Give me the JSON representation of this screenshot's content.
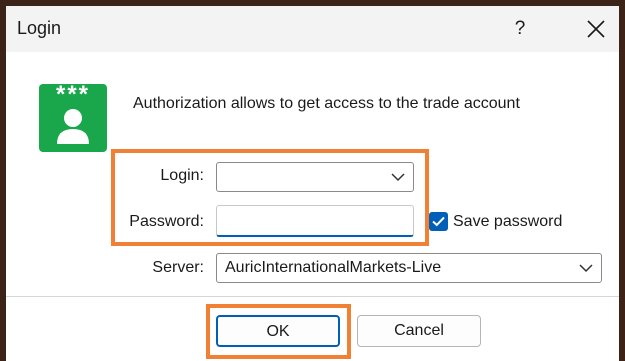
{
  "dialog": {
    "title": "Login",
    "help_label": "?",
    "close_label": "close"
  },
  "header": {
    "icon_stars": "***",
    "description": "Authorization allows to get access to the trade account"
  },
  "form": {
    "login_label": "Login:",
    "login_value": "",
    "password_label": "Password:",
    "password_value": "",
    "save_password_label": "Save password",
    "save_password_checked": true,
    "server_label": "Server:",
    "server_value": "AuricInternationalMarkets-Live"
  },
  "buttons": {
    "ok": "OK",
    "cancel": "Cancel"
  },
  "colors": {
    "accent": "#005fb8",
    "highlight": "#f08033",
    "icon_green": "#1aa64a"
  }
}
